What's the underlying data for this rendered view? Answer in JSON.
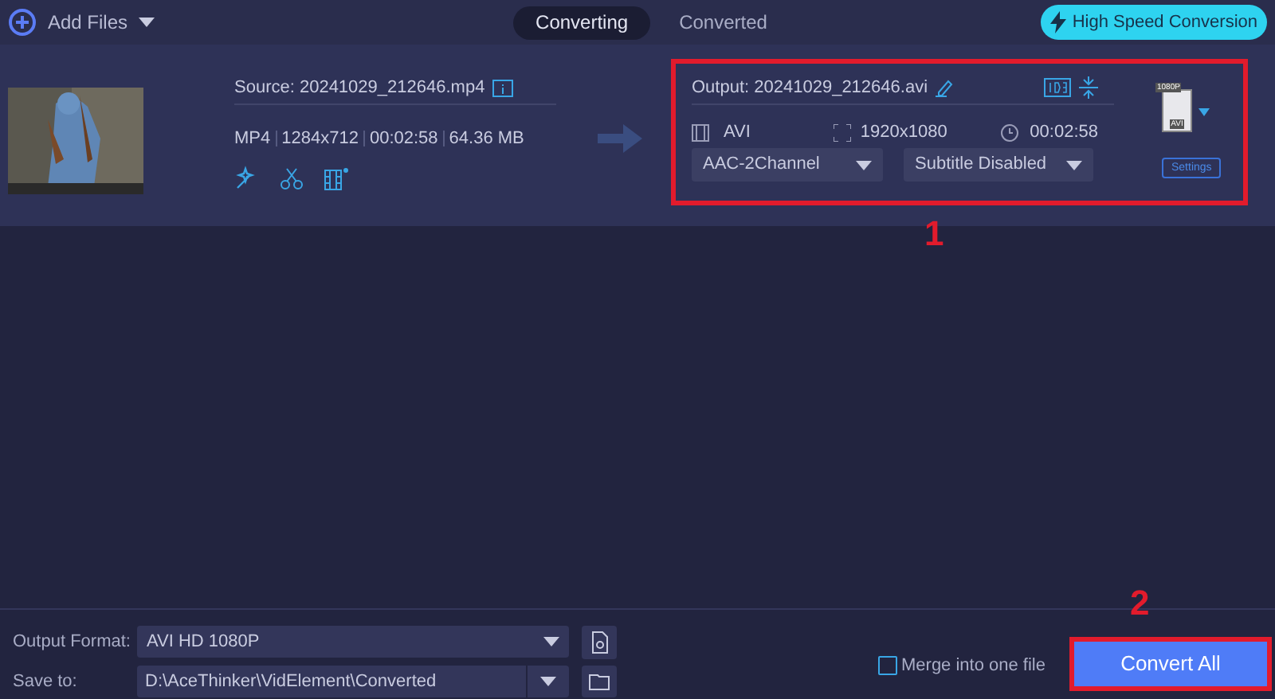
{
  "toolbar": {
    "add_files": "Add Files",
    "tabs": [
      {
        "label": "Converting",
        "selected": true
      },
      {
        "label": "Converted",
        "selected": false
      }
    ],
    "high_speed": "High Speed Conversion"
  },
  "file": {
    "source": "Source: 20241029_212646.mp4",
    "info": [
      "MP4",
      "1284x712",
      "00:02:58",
      "64.36 MB"
    ],
    "output": {
      "name": "Output: 20241029_212646.avi",
      "highlighted": true,
      "format": "AVI",
      "resolution": "1920x1080",
      "duration": "00:02:58",
      "audio": "AAC-2Channel",
      "subtitle": "Subtitle Disabled"
    },
    "format_badge": {
      "resolution": "1080P",
      "format": "AVI"
    },
    "settings": "Settings"
  },
  "bottom": {
    "output_format_label": "Output Format:",
    "output_format": "AVI HD 1080P",
    "save_to_label": "Save to:",
    "save_to": "D:\\AceThinker\\VidElement\\Converted",
    "merge": {
      "label": "Merge into one file",
      "checked": false
    },
    "convert_all": {
      "label": "Convert All",
      "highlighted": true
    }
  },
  "annotations": [
    "1",
    "2"
  ]
}
